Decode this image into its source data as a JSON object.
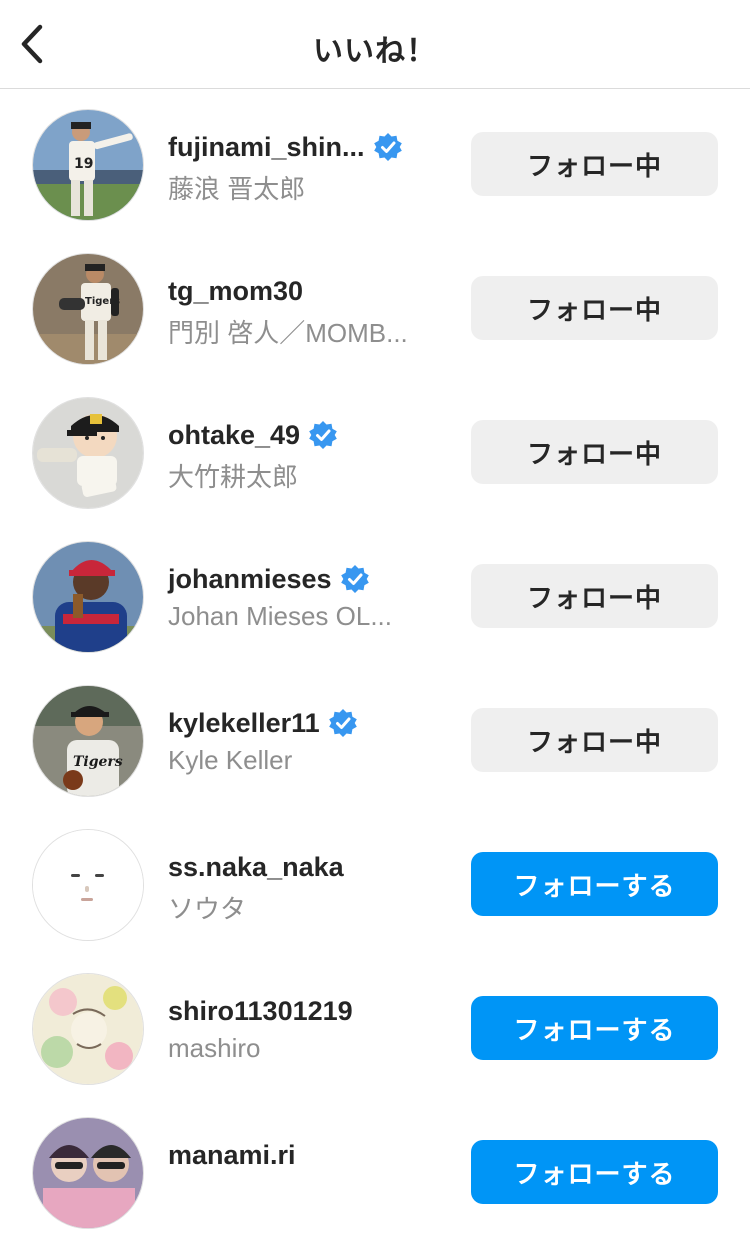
{
  "header": {
    "title": "いいね！"
  },
  "colors": {
    "accent": "#0095f6",
    "verified": "#3897f0",
    "secondary_text": "#8e8e8e"
  },
  "users": [
    {
      "username": "fujinami_shin...",
      "fullname": "藤浪 晋太郎",
      "verified": true,
      "button": "フォロー中",
      "following": true,
      "avatar": "baseball-player-pointing"
    },
    {
      "username": "tg_mom30",
      "fullname": "門別 啓人／MOMB...",
      "verified": false,
      "button": "フォロー中",
      "following": true,
      "avatar": "baseball-player-pitching"
    },
    {
      "username": "ohtake_49",
      "fullname": "大竹耕太郎",
      "verified": true,
      "button": "フォロー中",
      "following": true,
      "avatar": "cartoon-pitcher"
    },
    {
      "username": "johanmieses",
      "fullname": "Johan Mieses OL...",
      "verified": true,
      "button": "フォロー中",
      "following": true,
      "avatar": "baseball-player-red-cap"
    },
    {
      "username": "kylekeller11",
      "fullname": "Kyle Keller",
      "verified": true,
      "button": "フォロー中",
      "following": true,
      "avatar": "tigers-player"
    },
    {
      "username": "ss.naka_naka",
      "fullname": "ソウタ",
      "verified": false,
      "button": "フォローする",
      "following": false,
      "avatar": "minimal-face"
    },
    {
      "username": "shiro11301219",
      "fullname": "mashiro",
      "verified": false,
      "button": "フォローする",
      "following": false,
      "avatar": "floral-illustration"
    },
    {
      "username": "manami.ri",
      "fullname": "",
      "verified": false,
      "button": "フォローする",
      "following": false,
      "avatar": "two-people-photo"
    }
  ]
}
